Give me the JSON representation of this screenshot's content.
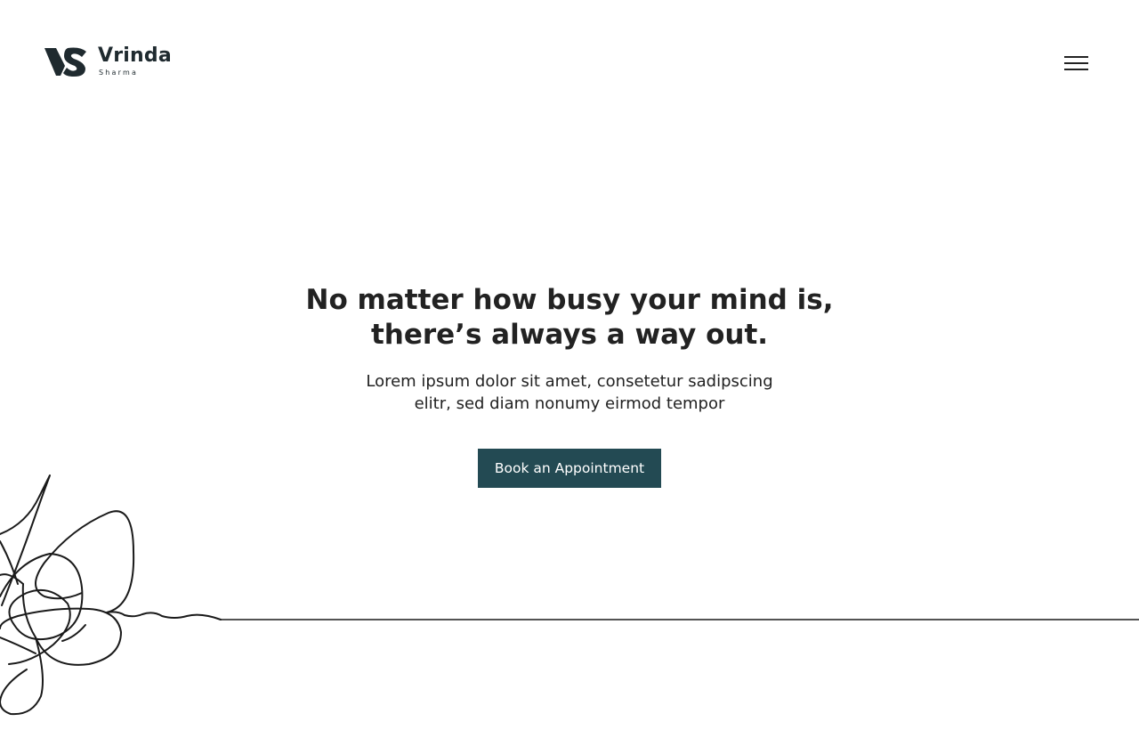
{
  "header": {
    "logo": {
      "name": "Vrinda",
      "subname": "Sharma",
      "icon": "vs-monogram-icon"
    },
    "menu_icon": "hamburger-menu-icon"
  },
  "hero": {
    "title_line1": "No matter how busy your mind is,",
    "title_line2": "there’s always a way out.",
    "subtitle_line1": "Lorem ipsum dolor sit amet, consetetur sadipscing",
    "subtitle_line2": "elitr, sed diam nonumy eirmod tempor",
    "cta_label": "Book an Appointment"
  },
  "colors": {
    "brand": "#234a53",
    "logo_dark": "#1f2a2f",
    "text": "#222222",
    "background": "#ffffff"
  },
  "decoration": {
    "illustration": "tangled-line-scribble"
  }
}
